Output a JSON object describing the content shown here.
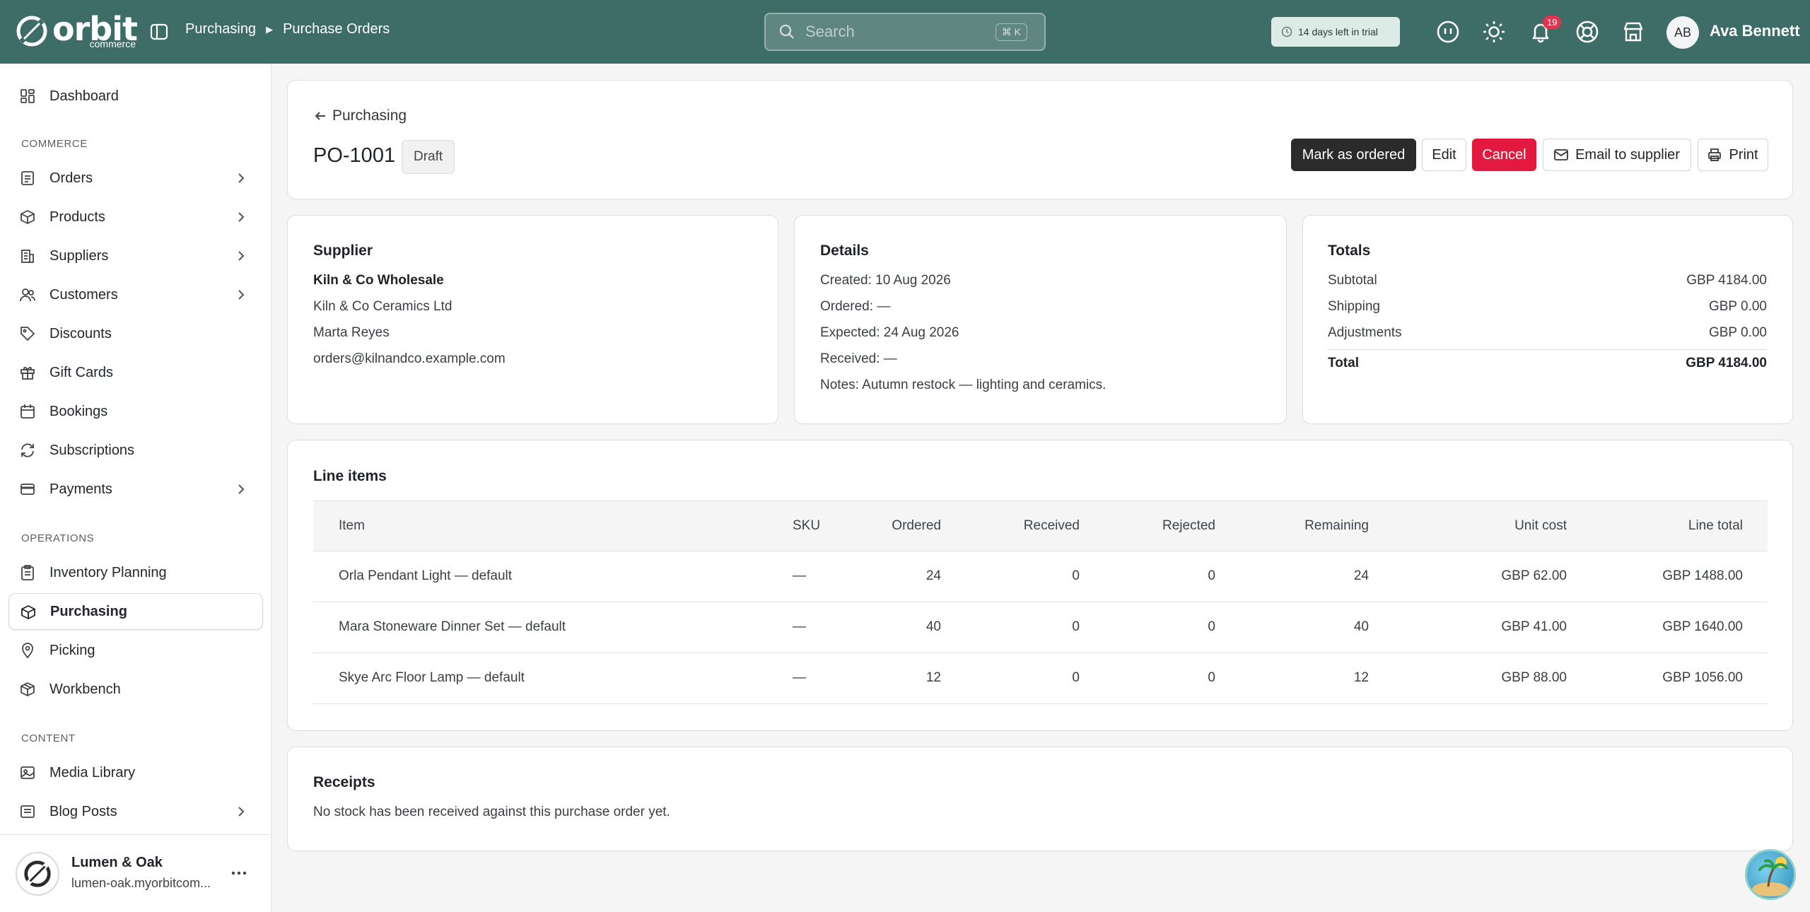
{
  "brand": {
    "name": "orbit",
    "sub": "commerce"
  },
  "header": {
    "breadcrumb": [
      "Purchasing",
      "Purchase Orders"
    ],
    "search_placeholder": "Search",
    "search_shortcut": "⌘ K",
    "trial_text": "14 days left in trial",
    "notifications_count": "19",
    "user_initials": "AB",
    "user_name": "Ava Bennett"
  },
  "sidebar": {
    "dashboard": "Dashboard",
    "sections": {
      "commerce": "COMMERCE",
      "operations": "OPERATIONS",
      "content": "CONTENT"
    },
    "commerce_items": [
      "Orders",
      "Products",
      "Suppliers",
      "Customers",
      "Discounts",
      "Gift Cards",
      "Bookings",
      "Subscriptions",
      "Payments"
    ],
    "operations_items": [
      "Inventory Planning",
      "Purchasing",
      "Picking",
      "Workbench"
    ],
    "content_items": [
      "Media Library",
      "Blog Posts"
    ],
    "active": "Purchasing",
    "shop": {
      "name": "Lumen & Oak",
      "url": "lumen-oak.myorbitcom..."
    }
  },
  "po": {
    "back_label": "Purchasing",
    "number": "PO-1001",
    "status": "Draft",
    "actions": {
      "mark_ordered": "Mark as ordered",
      "edit": "Edit",
      "cancel": "Cancel",
      "email": "Email to supplier",
      "print": "Print"
    }
  },
  "supplier": {
    "heading": "Supplier",
    "name": "Kiln & Co Wholesale",
    "company": "Kiln & Co Ceramics Ltd",
    "contact": "Marta Reyes",
    "email": "orders@kilnandco.example.com"
  },
  "details": {
    "heading": "Details",
    "created": "Created: 10 Aug 2026",
    "ordered": "Ordered: —",
    "expected": "Expected: 24 Aug 2026",
    "received": "Received: —",
    "notes": "Notes: Autumn restock — lighting and ceramics."
  },
  "totals": {
    "heading": "Totals",
    "subtotal_label": "Subtotal",
    "subtotal": "GBP 4184.00",
    "shipping_label": "Shipping",
    "shipping": "GBP 0.00",
    "adjustments_label": "Adjustments",
    "adjustments": "GBP 0.00",
    "total_label": "Total",
    "total": "GBP 4184.00"
  },
  "line_items": {
    "heading": "Line items",
    "columns": [
      "Item",
      "SKU",
      "Ordered",
      "Received",
      "Rejected",
      "Remaining",
      "Unit cost",
      "Line total"
    ],
    "rows": [
      [
        "Orla Pendant Light — default",
        "—",
        "24",
        "0",
        "0",
        "24",
        "GBP 62.00",
        "GBP 1488.00"
      ],
      [
        "Mara Stoneware Dinner Set — default",
        "—",
        "40",
        "0",
        "0",
        "40",
        "GBP 41.00",
        "GBP 1640.00"
      ],
      [
        "Skye Arc Floor Lamp — default",
        "—",
        "12",
        "0",
        "0",
        "12",
        "GBP 88.00",
        "GBP 1056.00"
      ]
    ]
  },
  "receipts": {
    "heading": "Receipts",
    "empty": "No stock has been received against this purchase order yet."
  },
  "colors": {
    "header_bg": "#3e6c67",
    "cancel": "#e3193f",
    "primary": "#2b2b2b",
    "badge": "#e0344f"
  }
}
